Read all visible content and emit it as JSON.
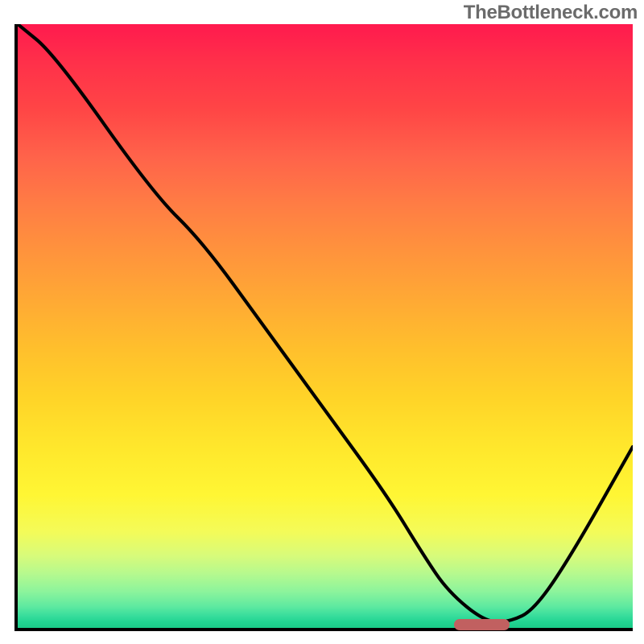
{
  "watermark": "TheBottleneck.com",
  "chart_data": {
    "type": "line",
    "title": "",
    "xlabel": "",
    "ylabel": "",
    "xlim": [
      0,
      100
    ],
    "ylim": [
      0,
      100
    ],
    "grid": false,
    "series": [
      {
        "name": "curve",
        "x": [
          0,
          6,
          22,
          30,
          40,
          50,
          60,
          66,
          70,
          76,
          80,
          84,
          90,
          100
        ],
        "values": [
          100,
          95,
          72,
          64,
          50,
          36,
          22,
          12,
          6,
          1,
          1,
          3,
          12,
          30
        ]
      }
    ],
    "marker": {
      "x_start": 71,
      "x_end": 80,
      "y": 0.5
    },
    "background_gradient": {
      "top": "#ff1a4e",
      "mid": "#ffe72c",
      "bottom": "#1acb88"
    }
  }
}
